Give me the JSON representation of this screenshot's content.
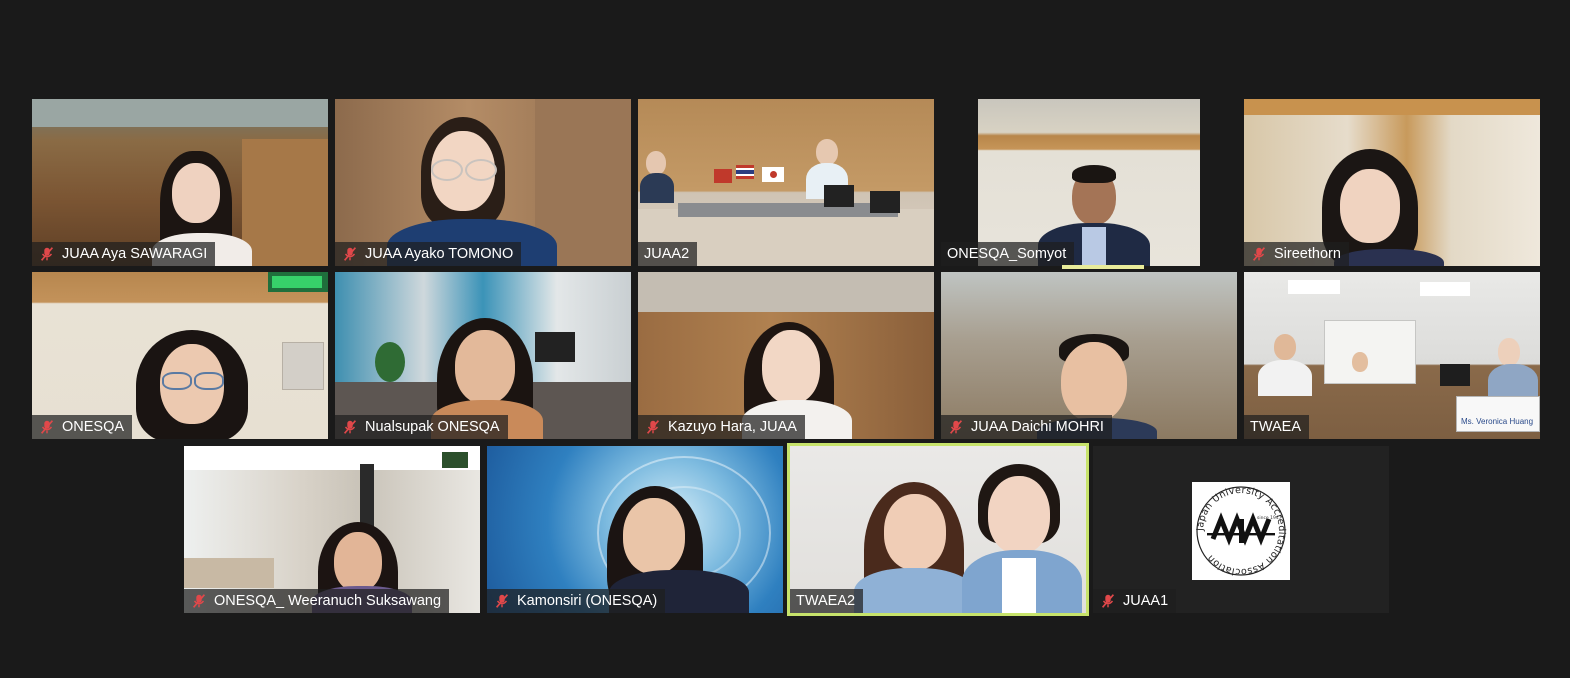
{
  "participants": [
    {
      "name": "JUAA Aya SAWARAGI",
      "muted": true
    },
    {
      "name": "JUAA Ayako TOMONO",
      "muted": true
    },
    {
      "name": "JUAA2",
      "muted": false
    },
    {
      "name": "ONESQA_Somyot",
      "muted": false,
      "speaking": true
    },
    {
      "name": "Sireethorn",
      "muted": true
    },
    {
      "name": "ONESQA",
      "muted": true
    },
    {
      "name": "Nualsupak ONESQA",
      "muted": true
    },
    {
      "name": "Kazuyo Hara, JUAA",
      "muted": true
    },
    {
      "name": "JUAA Daichi MOHRI",
      "muted": true
    },
    {
      "name": "TWAEA",
      "muted": false
    },
    {
      "name": "ONESQA_ Weeranuch Suksawang",
      "muted": true
    },
    {
      "name": "Kamonsiri (ONESQA)",
      "muted": true
    },
    {
      "name": "TWAEA2",
      "muted": false,
      "pinned_highlight": true
    },
    {
      "name": "JUAA1",
      "muted": true
    }
  ],
  "juaa_logo": {
    "ring_text": "Japan University Accreditation Association",
    "since": "since 1947"
  },
  "twaea_placard": "Ms. Veronica Huang",
  "colors": {
    "background": "#1a1a1a",
    "muted_icon": "#e0484a",
    "highlight": "#c7e36b"
  }
}
